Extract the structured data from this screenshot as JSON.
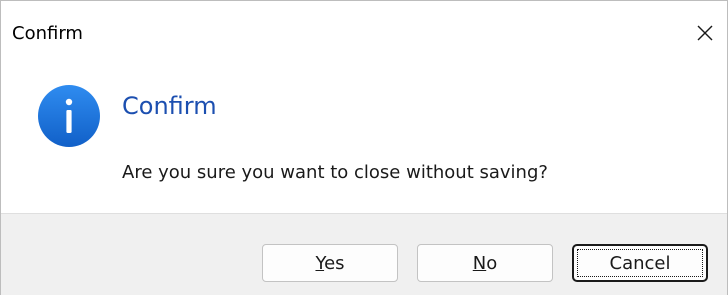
{
  "window": {
    "title": "Confirm",
    "close_icon": "close-icon"
  },
  "content": {
    "icon": "info-icon",
    "heading": "Confirm",
    "message": "Are you sure you want to close without saving?"
  },
  "buttons": {
    "yes": {
      "mnemonic": "Y",
      "rest": "es"
    },
    "no": {
      "mnemonic": "N",
      "rest": "o"
    },
    "cancel": {
      "label": "Cancel"
    }
  },
  "colors": {
    "heading": "#1c4fb0",
    "icon_fill": "#1a73d9",
    "footer_bg": "#f0f0f0"
  }
}
